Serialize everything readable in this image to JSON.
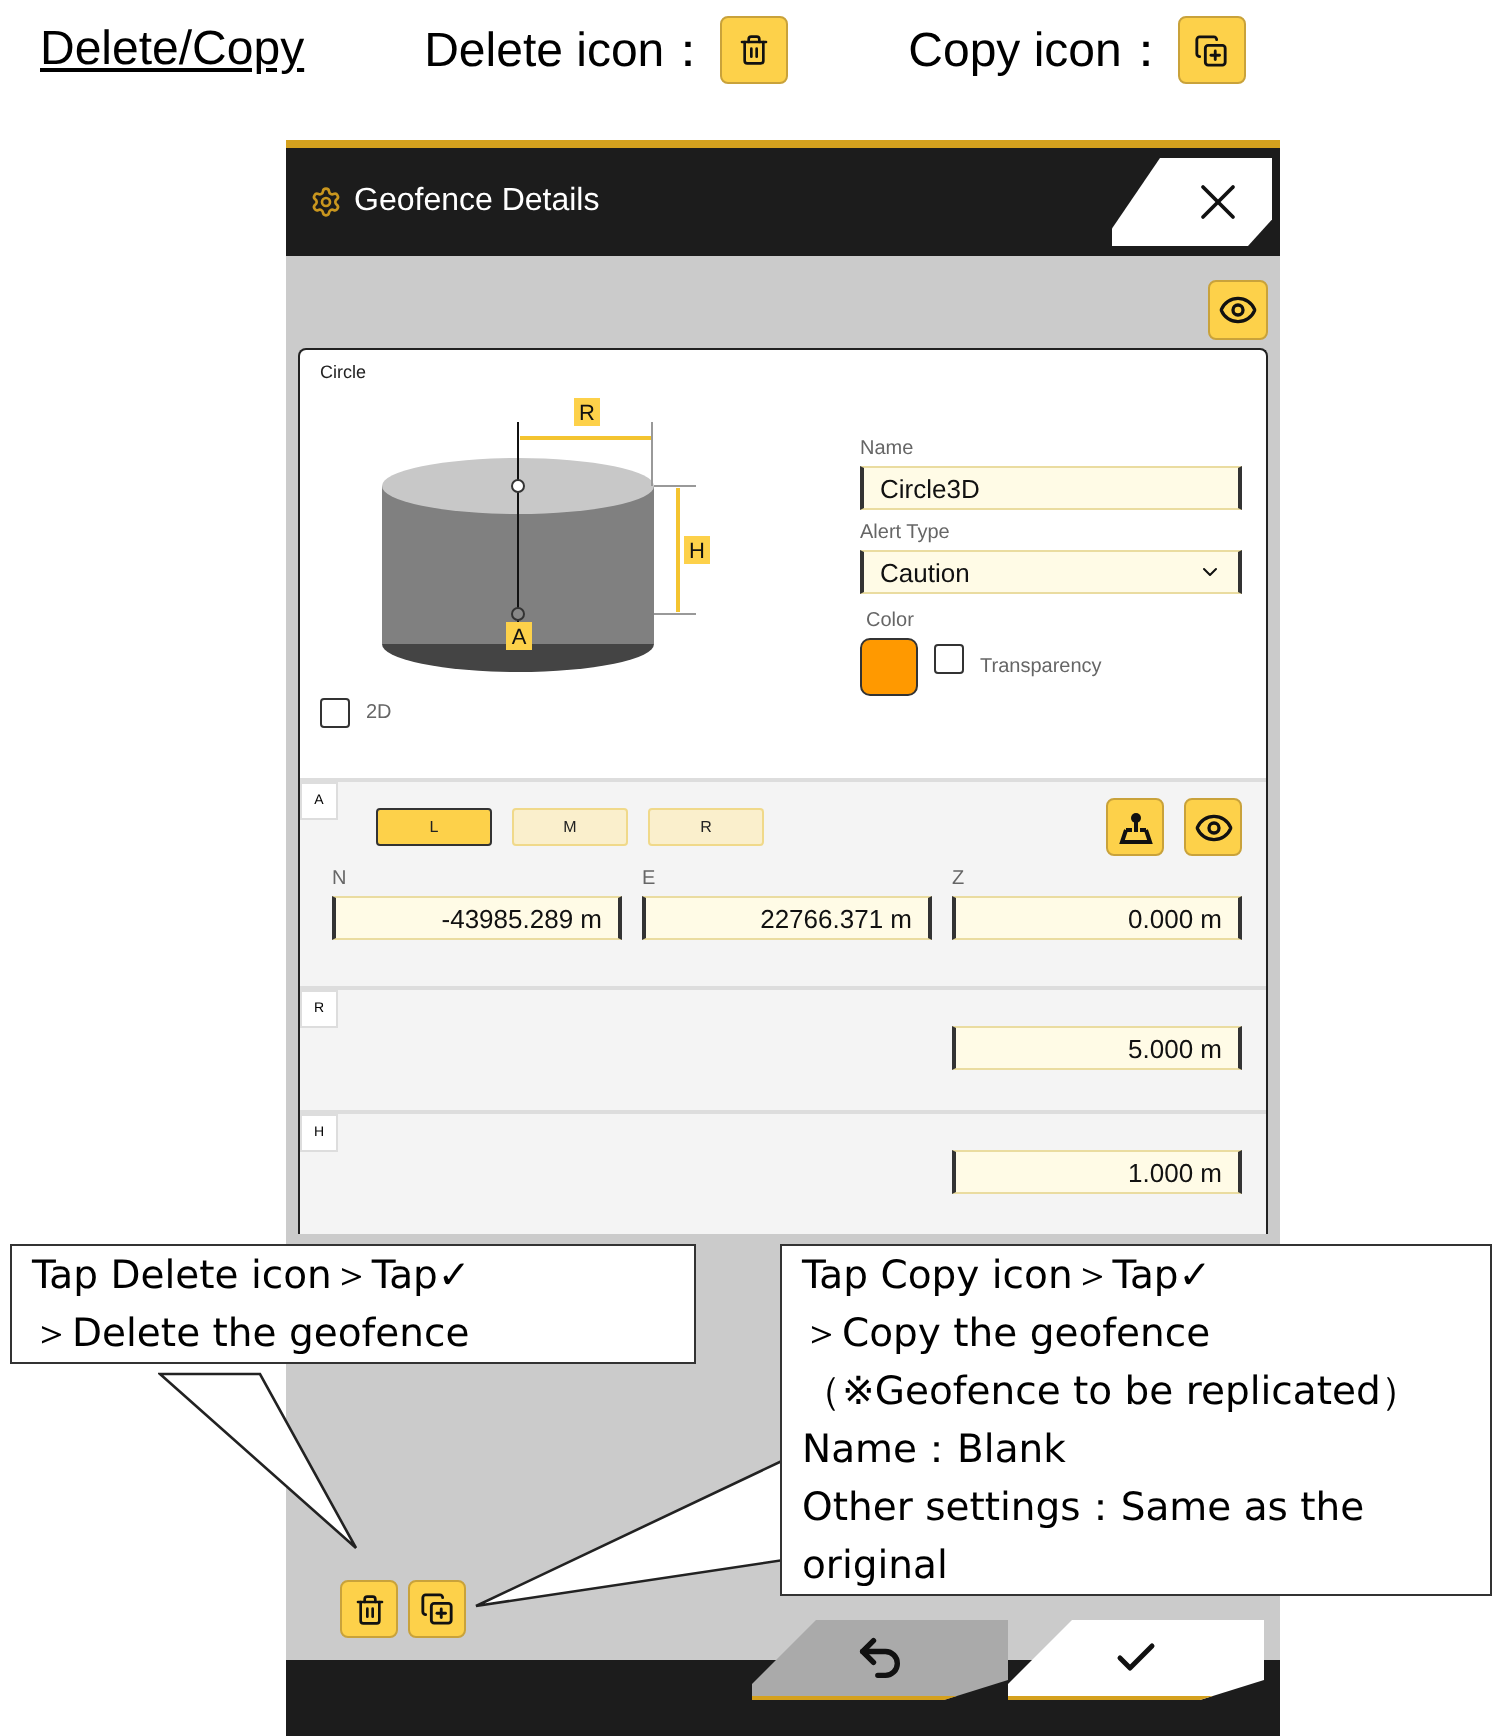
{
  "header": {
    "title": "Delete/Copy",
    "legend": [
      {
        "kind": "delete",
        "label": "Delete icon："
      },
      {
        "kind": "copy",
        "label": "Copy icon："
      }
    ]
  },
  "window": {
    "title": "Geofence Details"
  },
  "shape_tab": "Circle",
  "diagram_labels": {
    "radius": "R",
    "height": "H",
    "anchor": "A"
  },
  "two_d": {
    "label": "2D",
    "checked": false
  },
  "name": {
    "label": "Name",
    "value": "Circle3D"
  },
  "alert_type": {
    "label": "Alert Type",
    "value": "Caution"
  },
  "color": {
    "label": "Color",
    "color": "#ff9900"
  },
  "transparency": {
    "label": "Transparency",
    "checked": false
  },
  "sections": [
    {
      "tag": "A",
      "kind": "point",
      "modes": [
        {
          "label": "L",
          "selected": true
        },
        {
          "label": "M",
          "selected": false
        },
        {
          "label": "R",
          "selected": false
        }
      ],
      "columns": [
        {
          "label": "N",
          "value": "-43985.289 m"
        },
        {
          "label": "E",
          "value": "22766.371 m"
        },
        {
          "label": "Z",
          "value": "0.000 m"
        }
      ]
    },
    {
      "tag": "R",
      "kind": "value",
      "value": "5.000 m"
    },
    {
      "tag": "H",
      "kind": "value",
      "value": "1.000 m"
    }
  ],
  "callouts": [
    {
      "kind": "delete",
      "text": "Tap Delete icon＞Tap✓\n＞Delete the geofence"
    },
    {
      "kind": "copy",
      "text": "Tap Copy icon＞Tap✓\n＞Copy the geofence\n（※Geofence to be replicated）\nName：Blank\nOther settings：Same as the original"
    }
  ]
}
